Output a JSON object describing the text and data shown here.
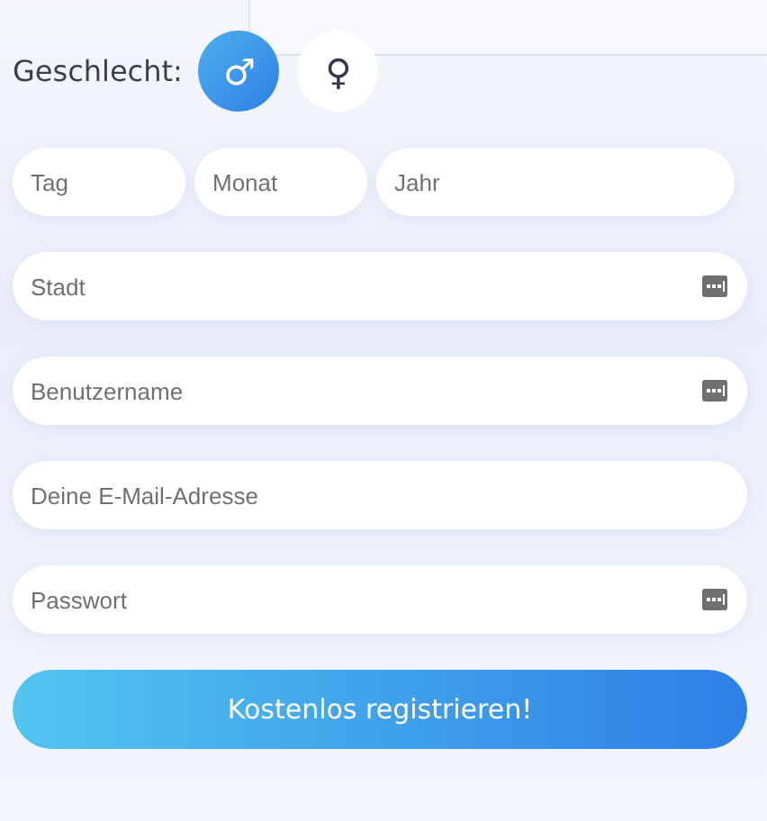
{
  "gender": {
    "label": "Geschlecht:",
    "options": [
      {
        "symbol": "♂",
        "selected": true
      },
      {
        "symbol": "♀",
        "selected": false
      }
    ]
  },
  "birthdate": [
    {
      "placeholder": "Tag"
    },
    {
      "placeholder": "Monat"
    },
    {
      "placeholder": "Jahr"
    }
  ],
  "fields": [
    {
      "placeholder": "Stadt",
      "key_icon": true
    },
    {
      "placeholder": "Benutzername",
      "key_icon": true
    },
    {
      "placeholder": "Deine E-Mail-Adresse",
      "key_icon": false
    },
    {
      "placeholder": "Passwort",
      "key_icon": true
    }
  ],
  "submit": "Kostenlos registrieren!"
}
